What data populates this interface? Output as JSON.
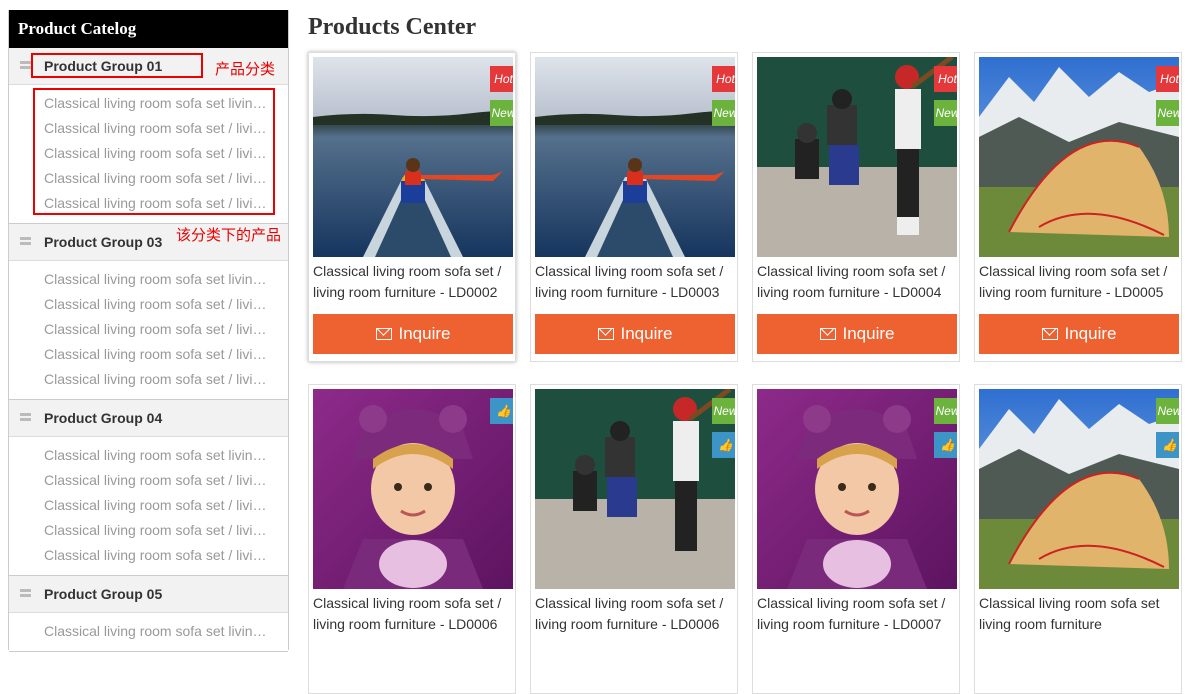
{
  "sidebar": {
    "title": "Product Catelog",
    "groups": [
      {
        "label": "Product Group 01",
        "items": [
          "Classical living room sofa set living room furniture",
          "Classical living room sofa set / living room furniture",
          "Classical living room sofa set / living room furniture",
          "Classical living room sofa set / living room furniture",
          "Classical living room sofa set / living room furniture"
        ]
      },
      {
        "label": "Product Group 03",
        "items": [
          "Classical living room sofa set living room furniture",
          "Classical living room sofa set / living room furniture",
          "Classical living room sofa set / living room furniture",
          "Classical living room sofa set / living room furniture",
          "Classical living room sofa set / living room furniture"
        ]
      },
      {
        "label": "Product Group 04",
        "items": [
          "Classical living room sofa set living room furniture",
          "Classical living room sofa set / living room furniture",
          "Classical living room sofa set / living room furniture",
          "Classical living room sofa set / living room furniture",
          "Classical living room sofa set / living room furniture"
        ]
      },
      {
        "label": "Product Group 05",
        "items": [
          "Classical living room sofa set living room furniture"
        ]
      }
    ]
  },
  "annotations": {
    "category": "产品分类",
    "products_under": "该分类下的产品"
  },
  "main": {
    "title": "Products Center",
    "inquire_label": "Inquire",
    "products": [
      {
        "title": "Classical living room sofa set / living room furniture - LD0002",
        "image": "kayak-lake",
        "badges": [
          "Hot",
          "New"
        ],
        "has_button": true
      },
      {
        "title": "Classical living room sofa set / living room furniture - LD0003",
        "image": "kayak-lake",
        "badges": [
          "Hot",
          "New"
        ],
        "has_button": true
      },
      {
        "title": "Classical living room sofa set / living room furniture - LD0004",
        "image": "baseball-players",
        "badges": [
          "Hot",
          "New"
        ],
        "has_button": true
      },
      {
        "title": "Classical living room sofa set / living room furniture - LD0005",
        "image": "mountain-tent",
        "badges": [
          "Hot",
          "New"
        ],
        "has_button": true
      },
      {
        "title": "Classical living room sofa set / living room furniture - LD0006",
        "image": "child-costume",
        "badges": [
          "like"
        ],
        "has_button": false
      },
      {
        "title": "Classical living room sofa set / living room furniture - LD0006",
        "image": "baseball-players",
        "badges": [
          "New",
          "like"
        ],
        "has_button": false
      },
      {
        "title": "Classical living room sofa set / living room furniture - LD0007",
        "image": "child-costume",
        "badges": [
          "New",
          "like"
        ],
        "has_button": false
      },
      {
        "title": "Classical living room sofa set living room furniture",
        "image": "mountain-tent",
        "badges": [
          "New",
          "like"
        ],
        "has_button": false
      }
    ],
    "badge_colors": {
      "hot": "#e5383b",
      "new": "#6cb33e",
      "like": "#3d95c7"
    },
    "button_color": "#ee6232"
  }
}
